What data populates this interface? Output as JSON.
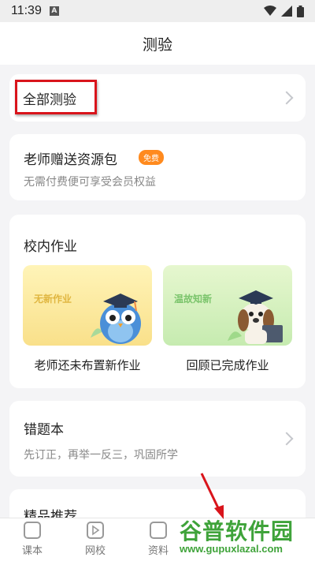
{
  "status_bar": {
    "time": "11:39",
    "notif_letter": "A"
  },
  "header": {
    "title": "测验"
  },
  "all_quiz": {
    "label": "全部测验"
  },
  "gift": {
    "title": "老师赠送资源包",
    "badge": "免费",
    "subtitle": "无需付费便可享受会员权益"
  },
  "school": {
    "title": "校内作业",
    "tiles": [
      {
        "tag": "无新作业",
        "caption": "老师还未布置新作业"
      },
      {
        "tag": "温故知新",
        "caption": "回顾已完成作业"
      }
    ]
  },
  "wrong_book": {
    "title": "错题本",
    "subtitle": "先订正，再举一反三，巩固所学"
  },
  "recommend": {
    "title": "精品推荐"
  },
  "bottom_nav": {
    "items": [
      {
        "label": "课本"
      },
      {
        "label": "网校"
      },
      {
        "label": "资料"
      }
    ]
  },
  "watermark": {
    "brand": "谷普软件园",
    "url": "www.gupuxlazal.com"
  },
  "colors": {
    "highlight": "#d9141b",
    "badge": "#ff8a1e",
    "watermark": "#3fa33a"
  }
}
